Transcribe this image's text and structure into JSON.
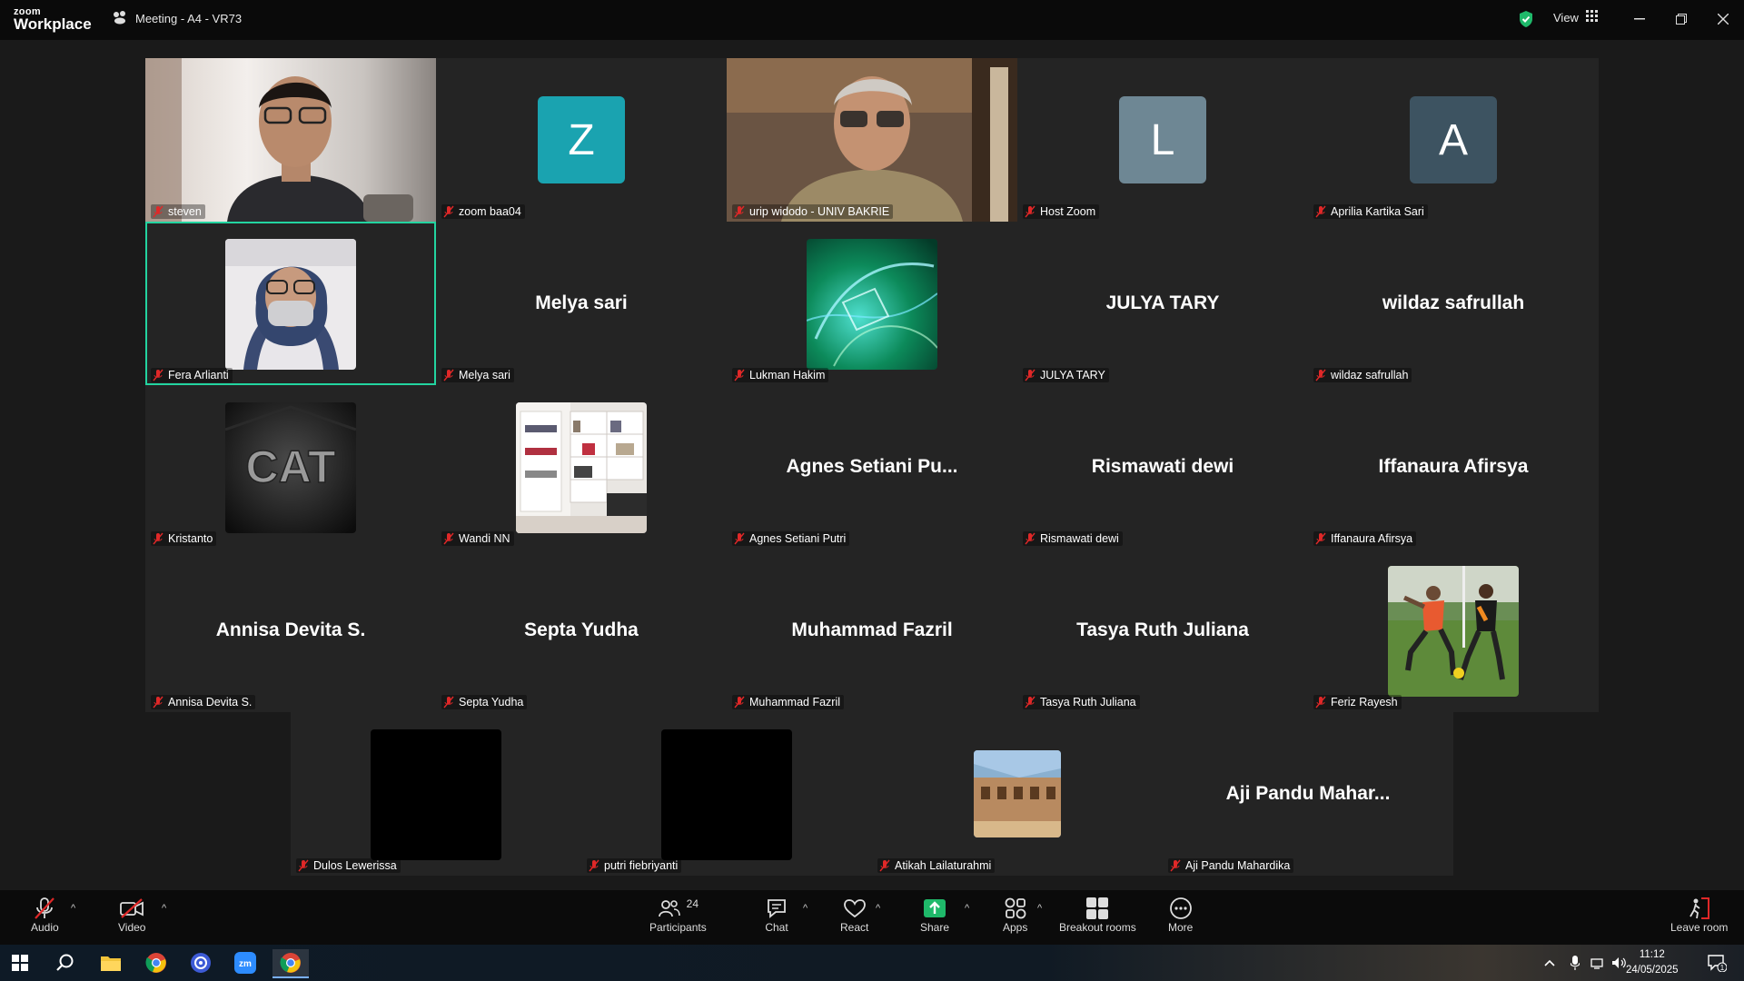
{
  "app": {
    "logo_top": "zoom",
    "logo_bottom": "Workplace",
    "meeting_title": "Meeting - A4 - VR73",
    "view_label": "View",
    "accent_color": "#23d4a0",
    "share_color": "#1fb96a"
  },
  "participants": [
    {
      "name": "steven",
      "type": "video"
    },
    {
      "name": "zoom baa04",
      "type": "letter",
      "letter": "Z",
      "color": "#1aa3b0"
    },
    {
      "name": "urip widodo - UNIV BAKRIE",
      "type": "video"
    },
    {
      "name": "Host Zoom",
      "type": "letter",
      "letter": "L",
      "color": "#6e8794"
    },
    {
      "name": "Aprilia Kartika Sari",
      "type": "letter",
      "letter": "A",
      "color": "#3d5361"
    },
    {
      "name": "Fera Arlianti",
      "type": "photo",
      "active": true
    },
    {
      "name": "Melya sari",
      "type": "text",
      "display": "Melya sari"
    },
    {
      "name": "Lukman Hakim",
      "type": "photo"
    },
    {
      "name": "JULYA TARY",
      "type": "text",
      "display": "JULYA TARY"
    },
    {
      "name": "wildaz safrullah",
      "type": "text",
      "display": "wildaz safrullah"
    },
    {
      "name": "Kristanto",
      "type": "photo"
    },
    {
      "name": "Wandi NN",
      "type": "photo"
    },
    {
      "name": "Agnes Setiani Putri",
      "type": "text",
      "display": "Agnes Setiani Pu..."
    },
    {
      "name": "Rismawati dewi",
      "type": "text",
      "display": "Rismawati dewi"
    },
    {
      "name": "Iffanaura Afirsya",
      "type": "text",
      "display": "Iffanaura Afirsya"
    },
    {
      "name": "Annisa Devita S.",
      "type": "text",
      "display": "Annisa Devita S."
    },
    {
      "name": "Septa Yudha",
      "type": "text",
      "display": "Septa Yudha"
    },
    {
      "name": "Muhammad Fazril",
      "type": "text",
      "display": "Muhammad Fazril"
    },
    {
      "name": "Tasya Ruth Juliana",
      "type": "text",
      "display": "Tasya Ruth Juliana"
    },
    {
      "name": "Feriz Rayesh",
      "type": "photo"
    },
    {
      "name": "Dulos Lewerissa",
      "type": "photo"
    },
    {
      "name": "putri fiebriyanti",
      "type": "photo"
    },
    {
      "name": "Atikah Lailaturahmi",
      "type": "photo"
    },
    {
      "name": "Aji Pandu Mahardika",
      "type": "text",
      "display": "Aji Pandu Mahar..."
    }
  ],
  "tile_photos": {
    "kristanto_logo": "CAT"
  },
  "toolbar": {
    "audio": "Audio",
    "video": "Video",
    "participants": "Participants",
    "participants_count": "24",
    "chat": "Chat",
    "react": "React",
    "share": "Share",
    "apps": "Apps",
    "breakout": "Breakout rooms",
    "more": "More",
    "leave": "Leave room"
  },
  "taskbar": {
    "time": "11:12",
    "date": "24/05/2025",
    "notification_count": "1"
  }
}
